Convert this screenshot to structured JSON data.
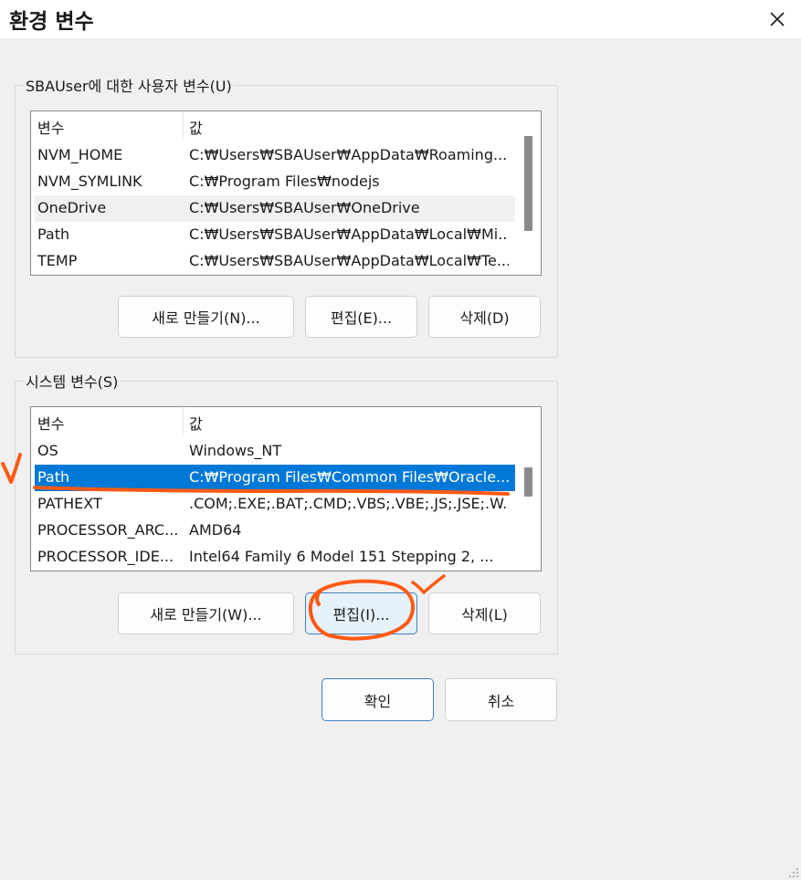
{
  "window": {
    "title": "환경 변수",
    "close_icon": "close-icon"
  },
  "user_vars": {
    "group_label": "SBAUser에 대한 사용자 변수(U)",
    "columns": [
      "변수",
      "값"
    ],
    "rows": [
      {
        "name": "NVM_HOME",
        "value": "C:₩Users₩SBAUser₩AppData₩Roaming..."
      },
      {
        "name": "NVM_SYMLINK",
        "value": "C:₩Program Files₩nodejs"
      },
      {
        "name": "OneDrive",
        "value": "C:₩Users₩SBAUser₩OneDrive"
      },
      {
        "name": "Path",
        "value": "C:₩Users₩SBAUser₩AppData₩Local₩Mi..."
      },
      {
        "name": "TEMP",
        "value": "C:₩Users₩SBAUser₩AppData₩Local₩Te..."
      }
    ],
    "hovered_row": "OneDrive",
    "buttons": {
      "new": "새로 만들기(N)...",
      "edit": "편집(E)...",
      "delete": "삭제(D)"
    }
  },
  "system_vars": {
    "group_label": "시스템 변수(S)",
    "columns": [
      "변수",
      "값"
    ],
    "rows": [
      {
        "name": "OS",
        "value": "Windows_NT"
      },
      {
        "name": "Path",
        "value": "C:₩Program Files₩Common Files₩Oracle..."
      },
      {
        "name": "PATHEXT",
        "value": ".COM;.EXE;.BAT;.CMD;.VBS;.VBE;.JS;.JSE;.W..."
      },
      {
        "name": "PROCESSOR_ARC...",
        "value": "AMD64"
      },
      {
        "name": "PROCESSOR_IDE...",
        "value": "Intel64 Family 6 Model 151 Stepping 2, ..."
      }
    ],
    "selected_row": "Path",
    "buttons": {
      "new": "새로 만들기(W)...",
      "edit": "편집(I)...",
      "delete": "삭제(L)"
    }
  },
  "footer": {
    "ok": "확인",
    "cancel": "취소"
  },
  "colors": {
    "selection": "#0078d7",
    "annotation": "#ff5a14",
    "focus_border": "#3f7fc6",
    "window_bg": "#f0f0f0"
  }
}
